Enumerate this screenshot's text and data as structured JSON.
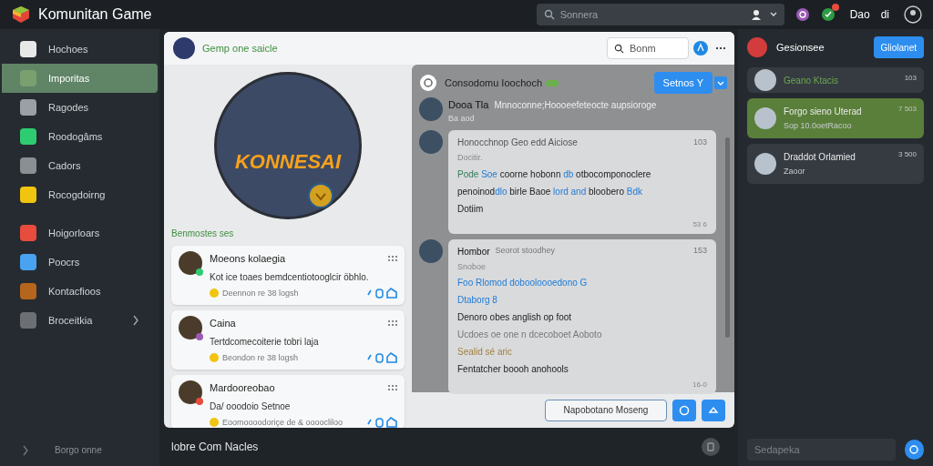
{
  "app": {
    "title": "Komunitan Game"
  },
  "top_bar": {
    "search": {
      "placeholder": "Sonnera"
    },
    "notifications": {
      "badge": true
    },
    "user_label": "Dao",
    "user_short": "di"
  },
  "sidebar": {
    "items": [
      {
        "label": "Hochoes",
        "selected": false,
        "has_submenu": false
      },
      {
        "label": "Imporitas",
        "selected": true,
        "has_submenu": false
      },
      {
        "label": "Ragodes",
        "selected": false,
        "has_submenu": false
      },
      {
        "label": "Roodogâms",
        "selected": false,
        "has_submenu": false
      },
      {
        "label": "Cadors",
        "selected": false,
        "has_submenu": false
      },
      {
        "label": "Rocogdoirng",
        "selected": false,
        "has_submenu": false
      },
      {
        "label": "Hoigorloars",
        "selected": false,
        "has_submenu": false
      },
      {
        "label": "Poocrs",
        "selected": false,
        "has_submenu": false
      },
      {
        "label": "Kontacfioos",
        "selected": false,
        "has_submenu": false
      },
      {
        "label": "Broceitkia",
        "selected": false,
        "has_submenu": true
      }
    ],
    "footer": "Borgo onne"
  },
  "profile": {
    "title": "Gemp one saicle",
    "search": {
      "placeholder": "Bonm"
    },
    "banner_text": "KONNESAI",
    "section_label": "Benmostes ses",
    "posts": [
      {
        "author": "Moeons kolaegia",
        "text": "Kot ice toaes bemdcentiotooglcir öbhlo.",
        "meta": "Deennon re 38 logsh",
        "color": "#2ecc71"
      },
      {
        "author": "Caina",
        "text": "Tertdcomecoiterie tobri laja",
        "meta": "Beondon re 38 logsh",
        "color": "#9b59b6"
      },
      {
        "author": "Mardooreobao",
        "text": "Da/ ooodoio Setnoe",
        "meta": "Eoomoooodoriçe de  & oooocliloo",
        "color": "#e74c3c"
      }
    ]
  },
  "chat": {
    "title": "Consodomu Ioochoch",
    "title_badge": true,
    "action_button": "Setnos Y",
    "messages": [
      {
        "kind": "plain",
        "author": "Dooa Tla",
        "text": "Mnnoconne;Hoooeefeteocte aupsioroge",
        "sub": "Ba aod"
      },
      {
        "kind": "bubble",
        "author": "Honocchnop Geo edd Aiciose",
        "time": "103",
        "sub": "Docitir.",
        "lines": [
          [
            {
              "text": "Pode ",
              "kind": "green"
            },
            {
              "text": "Soe",
              "kind": "link"
            },
            {
              "text": " coorne hobonn ",
              "kind": "plain"
            },
            {
              "text": "db",
              "kind": "link"
            },
            {
              "text": " otbocomponoclere",
              "kind": "plain"
            }
          ],
          [
            {
              "text": "penoinod",
              "kind": "plain"
            },
            {
              "text": "dlo",
              "kind": "link"
            },
            {
              "text": " birle Baoe ",
              "kind": "plain"
            },
            {
              "text": "lord and",
              "kind": "link"
            },
            {
              "text": " bloobero ",
              "kind": "plain"
            },
            {
              "text": "Bdk",
              "kind": "link"
            }
          ],
          [
            {
              "text": "Dotiim",
              "kind": "plain"
            }
          ]
        ],
        "footer": "53 6"
      },
      {
        "kind": "bubble",
        "author": "Hombor",
        "author_note": "Seorot stoodhey",
        "time": "153",
        "sub": "Snoboe",
        "lines": [
          [
            {
              "text": "Foo Rlomod dobooloooedono G",
              "kind": "link"
            }
          ],
          [
            {
              "text": "Dtaborg 8",
              "kind": "link"
            }
          ],
          [
            {
              "text": "Denoro obes anglish op foot",
              "kind": "plain"
            }
          ],
          [
            {
              "text": "Ucdoes oe one n dcecoboet  Aoboto",
              "kind": "muted"
            }
          ],
          [
            {
              "text": "Sealid sé aric",
              "kind": "tan"
            }
          ],
          [
            {
              "text": "Fentatcher boooh anohools",
              "kind": "plain"
            }
          ]
        ],
        "footer": "16-0"
      }
    ],
    "composer": {
      "placeholder": "Napobotano Moseng"
    }
  },
  "bottom_bar": {
    "label": "lobre Com Nacles"
  },
  "right_panel": {
    "title": "Gesionsee",
    "button": "Gliolanet",
    "items": [
      {
        "name": "Geano Ktacis",
        "count": "103",
        "selected": false
      },
      {
        "name": "Forgo sieno Uterad",
        "sub": "Sop 10.0oetRacoo",
        "count": "7 503",
        "selected": true
      },
      {
        "name": "Draddot Orlamied",
        "sub": "Zaoor",
        "count": "3 500",
        "selected": false
      }
    ],
    "search": {
      "placeholder": "Sedapeka"
    }
  }
}
